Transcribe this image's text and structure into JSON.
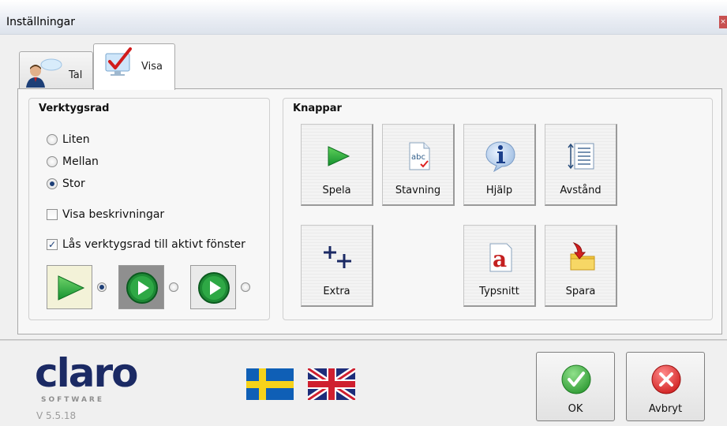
{
  "window": {
    "title": "Inställningar",
    "close_icon": "close-icon"
  },
  "tabs": [
    {
      "label": "Tal",
      "icon": "speaker-person-icon",
      "selected": false
    },
    {
      "label": "Visa",
      "icon": "monitor-check-icon",
      "selected": true
    }
  ],
  "toolbar_group": {
    "title": "Verktygsrad",
    "size_options": [
      {
        "label": "Liten",
        "selected": false
      },
      {
        "label": "Mellan",
        "selected": false
      },
      {
        "label": "Stor",
        "selected": true
      }
    ],
    "checkboxes": [
      {
        "label": "Visa beskrivningar",
        "checked": false
      },
      {
        "label": "Lås verktygsrad till aktivt fönster",
        "checked": true
      }
    ],
    "style_options": [
      {
        "name": "flat-triangle-style",
        "selected": true
      },
      {
        "name": "dark-circle-style",
        "selected": false
      },
      {
        "name": "light-circle-style",
        "selected": false
      }
    ]
  },
  "buttons_group": {
    "title": "Knappar",
    "buttons": [
      {
        "label": "Spela",
        "icon": "play-icon"
      },
      {
        "label": "Stavning",
        "icon": "spelling-icon"
      },
      {
        "label": "Hjälp",
        "icon": "info-icon"
      },
      {
        "label": "Avstånd",
        "icon": "line-spacing-icon"
      },
      {
        "label": "Extra",
        "icon": "plus-plus-icon"
      },
      {
        "label": "Typsnitt",
        "icon": "font-icon"
      },
      {
        "label": "Spara",
        "icon": "save-folder-icon"
      }
    ]
  },
  "footer": {
    "logo_main": "claro",
    "logo_sub": "SOFTWARE",
    "version": "V 5.5.18",
    "flags": [
      "swedish-flag-icon",
      "uk-flag-icon"
    ],
    "ok_label": "OK",
    "cancel_label": "Avbryt"
  },
  "colors": {
    "accent_navy": "#1b2a64",
    "play_green": "#1aa23b",
    "ok_green": "#3aa53d",
    "cancel_red": "#d43131"
  }
}
